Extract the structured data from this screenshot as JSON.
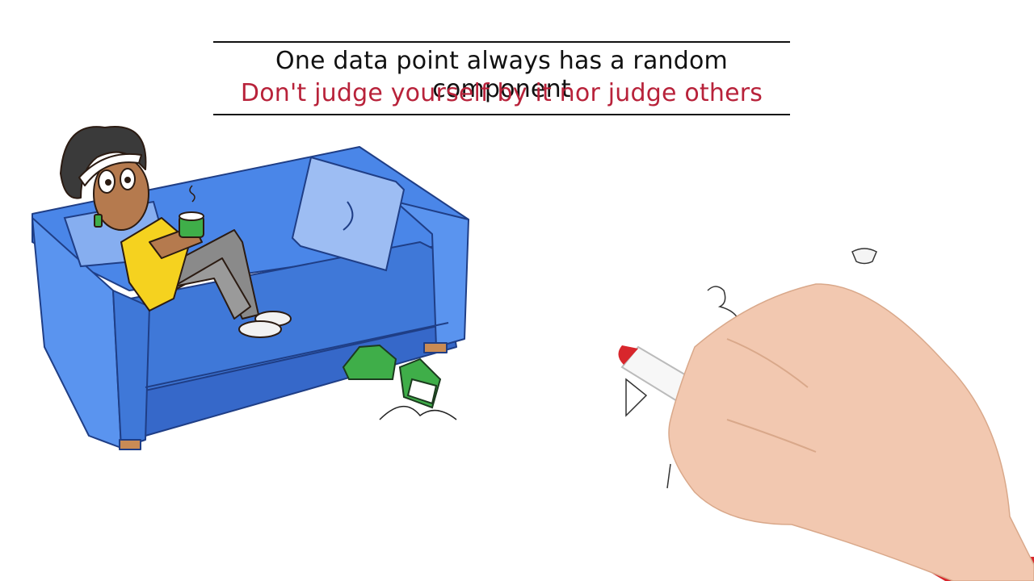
{
  "caption": {
    "line1": "One data point always has a random component",
    "line2": "Don't judge yourself by it nor judge others"
  },
  "colors": {
    "text_primary": "#111111",
    "text_accent": "#b8223a",
    "sofa": "#4a86e8",
    "shirt": "#f5d21f",
    "shoes": "#3fae49",
    "marker_cap": "#d8262c"
  },
  "icons": [
    "sofa",
    "woman-with-mug",
    "pillow",
    "sneakers",
    "hand-with-marker"
  ]
}
